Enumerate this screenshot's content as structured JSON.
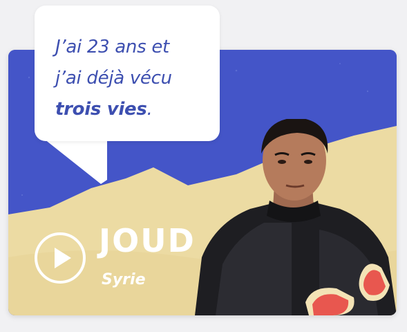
{
  "testimony": {
    "quote_line1": "J’ai 23 ans et",
    "quote_line2": "j’ai déjà vécu",
    "quote_emphasis": "trois vies",
    "quote_end": ".",
    "name": "JOUD",
    "country": "Syrie"
  },
  "icons": {
    "play": "play-icon",
    "person": "person-photo"
  },
  "colors": {
    "sky": "#4455c8",
    "sand": "#ecdba3",
    "quote_text": "#3d4fb0",
    "accent_red": "#e8574f"
  }
}
